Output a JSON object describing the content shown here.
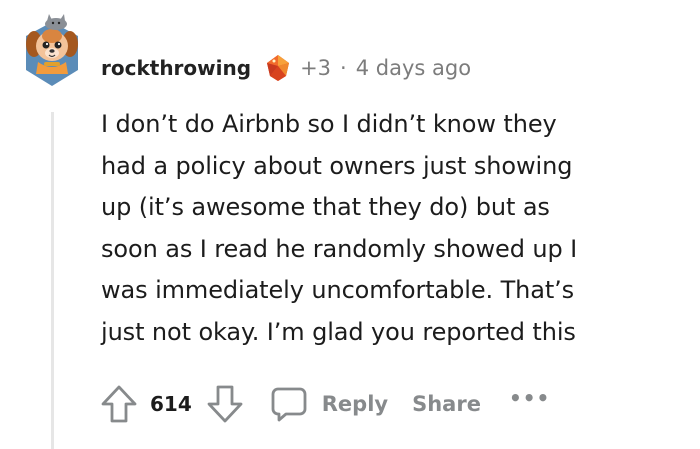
{
  "comment": {
    "author": "rockthrowing",
    "award_icon": "ruby-gem-award-icon",
    "award_count": "+3",
    "separator": "·",
    "timestamp": "4 days ago",
    "body_lines": [
      "I don’t do Airbnb so I didn’t know they",
      "had a policy about owners just showing",
      "up (it’s awesome that they do) but as",
      "soon as I read he randomly showed up I",
      "was immediately uncomfortable. That’s",
      "just not okay. I’m glad you reported this"
    ]
  },
  "actions": {
    "upvote_icon": "arrow-up-icon",
    "vote_count": "614",
    "downvote_icon": "arrow-down-icon",
    "reply_icon": "speech-bubble-icon",
    "reply_label": "Reply",
    "share_label": "Share",
    "more_label": "•••"
  },
  "colors": {
    "meta_gray": "#7c7c7c",
    "action_gray": "#878a8c",
    "text": "#1c1c1c",
    "thread_line": "#e6e6e6"
  }
}
